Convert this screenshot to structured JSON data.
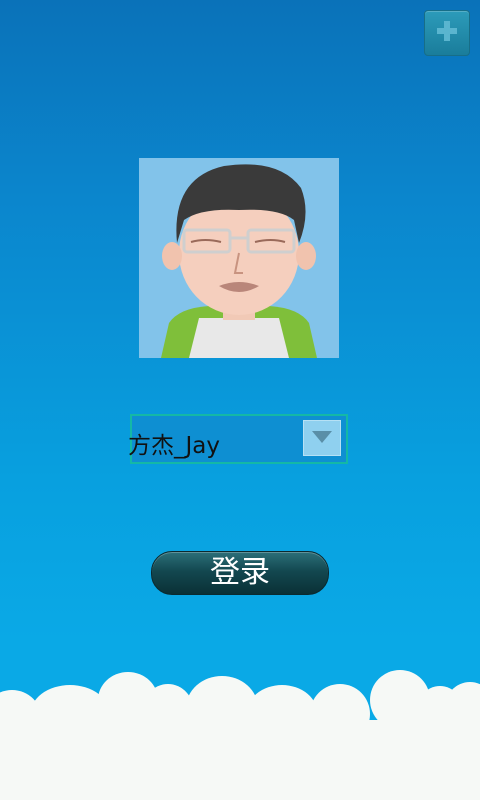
{
  "header": {
    "add_icon": "plus-icon"
  },
  "profile": {
    "avatar_icon": "cartoon-avatar-icon"
  },
  "account": {
    "selected": "方杰_Jay",
    "dropdown_icon": "triangle-down-icon"
  },
  "login": {
    "label": "登录"
  },
  "colors": {
    "sky_top": "#0a72b9",
    "sky_bottom": "#0aa9e6",
    "cloud": "#f6f9f6",
    "button_dark": "#134850",
    "select_border": "#14b8a6"
  }
}
